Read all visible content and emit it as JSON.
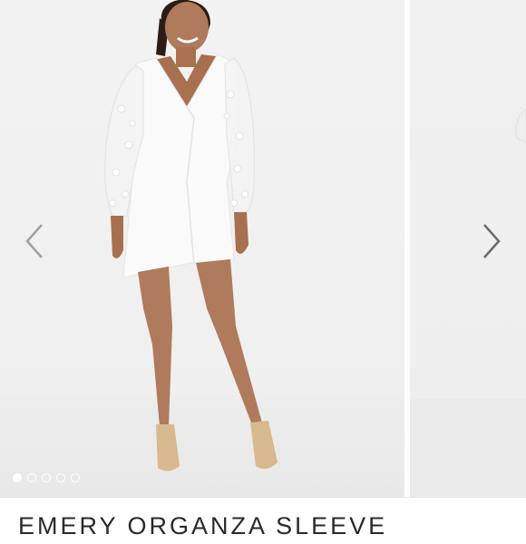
{
  "listing": {
    "title": "EMERY ORGANZA SLEEVE"
  },
  "carousel": {
    "image_alt": "Model wearing white wrap mini dress with embroidered organza sleeves",
    "prev_icon": "chevron-left-icon",
    "next_icon": "chevron-right-icon",
    "slide_count": 5,
    "active_slide": 1
  },
  "colors": {
    "background": "#f1f1f1",
    "dress": "#fafafa",
    "arrow": "#9a9a9a",
    "text": "#2a2a2a"
  }
}
